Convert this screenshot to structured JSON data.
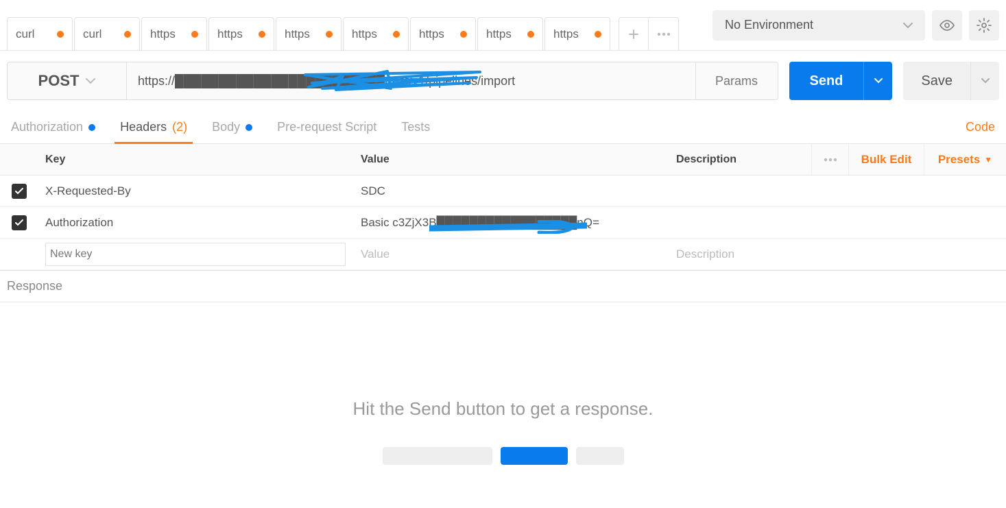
{
  "topbar": {
    "tabs": [
      {
        "label": "curl"
      },
      {
        "label": "curl"
      },
      {
        "label": "https"
      },
      {
        "label": "https"
      },
      {
        "label": "https"
      },
      {
        "label": "https"
      },
      {
        "label": "https"
      },
      {
        "label": "https"
      },
      {
        "label": "https"
      }
    ],
    "environment": "No Environment"
  },
  "request": {
    "method": "POST",
    "url": "https://████████████████████████/rest/v1/pipelines/import",
    "params_label": "Params",
    "send_label": "Send",
    "save_label": "Save"
  },
  "subtabs": {
    "authorization": "Authorization",
    "headers": "Headers",
    "headers_count": "(2)",
    "body": "Body",
    "pre_request": "Pre-request Script",
    "tests": "Tests",
    "code_link": "Code"
  },
  "headers_table": {
    "columns": {
      "key": "Key",
      "value": "Value",
      "description": "Description"
    },
    "bulk_edit": "Bulk Edit",
    "presets": "Presets",
    "rows": [
      {
        "enabled": true,
        "key": "X-Requested-By",
        "value": "SDC",
        "description": ""
      },
      {
        "enabled": true,
        "key": "Authorization",
        "value": "Basic c3ZjX3B█████████████████nQ=",
        "description": ""
      }
    ],
    "new_row": {
      "key_placeholder": "New key",
      "value_placeholder": "Value",
      "description_placeholder": "Description"
    }
  },
  "response": {
    "title": "Response",
    "message": "Hit the Send button to get a response."
  }
}
